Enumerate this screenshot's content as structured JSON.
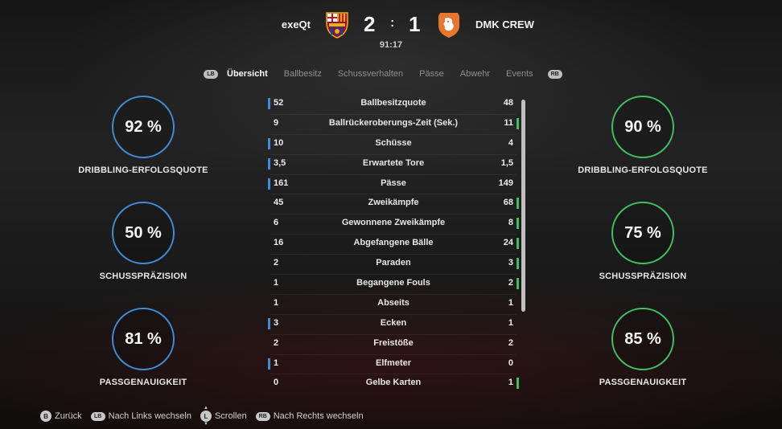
{
  "match": {
    "home": {
      "name": "exeQt",
      "score": "2",
      "crest_icon": "barcelona-crest-icon",
      "color": "#3d8dd6"
    },
    "away": {
      "name": "DMK CREW",
      "score": "1",
      "crest_icon": "netherlands-lion-crest-icon",
      "color": "#3fbf63"
    },
    "separator": ":",
    "clock": "91:17"
  },
  "tabs": {
    "left_bumper": "LB",
    "right_bumper": "RB",
    "items": [
      "Übersicht",
      "Ballbesitz",
      "Schussverhalten",
      "Pässe",
      "Abwehr",
      "Events"
    ],
    "active": "Übersicht"
  },
  "rings": {
    "home": [
      {
        "value": "92 %",
        "label": "DRIBBLING-ERFOLGSQUOTE",
        "fraction": 0.92
      },
      {
        "value": "50 %",
        "label": "SCHUSSPRÄZISION",
        "fraction": 0.5
      },
      {
        "value": "81 %",
        "label": "PASSGENAUIGKEIT",
        "fraction": 0.81
      }
    ],
    "away": [
      {
        "value": "90 %",
        "label": "DRIBBLING-ERFOLGSQUOTE",
        "fraction": 0.9
      },
      {
        "value": "75 %",
        "label": "SCHUSSPRÄZISION",
        "fraction": 0.75
      },
      {
        "value": "85 %",
        "label": "PASSGENAUIGKEIT",
        "fraction": 0.85
      }
    ]
  },
  "stats": [
    {
      "home": "52",
      "name": "Ballbesitzquote",
      "away": "48",
      "leader": "home"
    },
    {
      "home": "9",
      "name": "Ballrückeroberungs-Zeit (Sek.)",
      "away": "11",
      "leader": "away"
    },
    {
      "home": "10",
      "name": "Schüsse",
      "away": "4",
      "leader": "home"
    },
    {
      "home": "3,5",
      "name": "Erwartete Tore",
      "away": "1,5",
      "leader": "home"
    },
    {
      "home": "161",
      "name": "Pässe",
      "away": "149",
      "leader": "home"
    },
    {
      "home": "45",
      "name": "Zweikämpfe",
      "away": "68",
      "leader": "away"
    },
    {
      "home": "6",
      "name": "Gewonnene Zweikämpfe",
      "away": "8",
      "leader": "away"
    },
    {
      "home": "16",
      "name": "Abgefangene Bälle",
      "away": "24",
      "leader": "away"
    },
    {
      "home": "2",
      "name": "Paraden",
      "away": "3",
      "leader": "away"
    },
    {
      "home": "1",
      "name": "Begangene Fouls",
      "away": "2",
      "leader": "away"
    },
    {
      "home": "1",
      "name": "Abseits",
      "away": "1",
      "leader": "none"
    },
    {
      "home": "3",
      "name": "Ecken",
      "away": "1",
      "leader": "home"
    },
    {
      "home": "2",
      "name": "Freistöße",
      "away": "2",
      "leader": "none"
    },
    {
      "home": "1",
      "name": "Elfmeter",
      "away": "0",
      "leader": "home"
    },
    {
      "home": "0",
      "name": "Gelbe Karten",
      "away": "1",
      "leader": "away"
    }
  ],
  "hints": [
    {
      "button": "B",
      "label": "Zurück"
    },
    {
      "button": "LB",
      "label": "Nach Links wechseln"
    },
    {
      "button": "L",
      "label": "Scrollen"
    },
    {
      "button": "RB",
      "label": "Nach Rechts wechseln"
    }
  ]
}
